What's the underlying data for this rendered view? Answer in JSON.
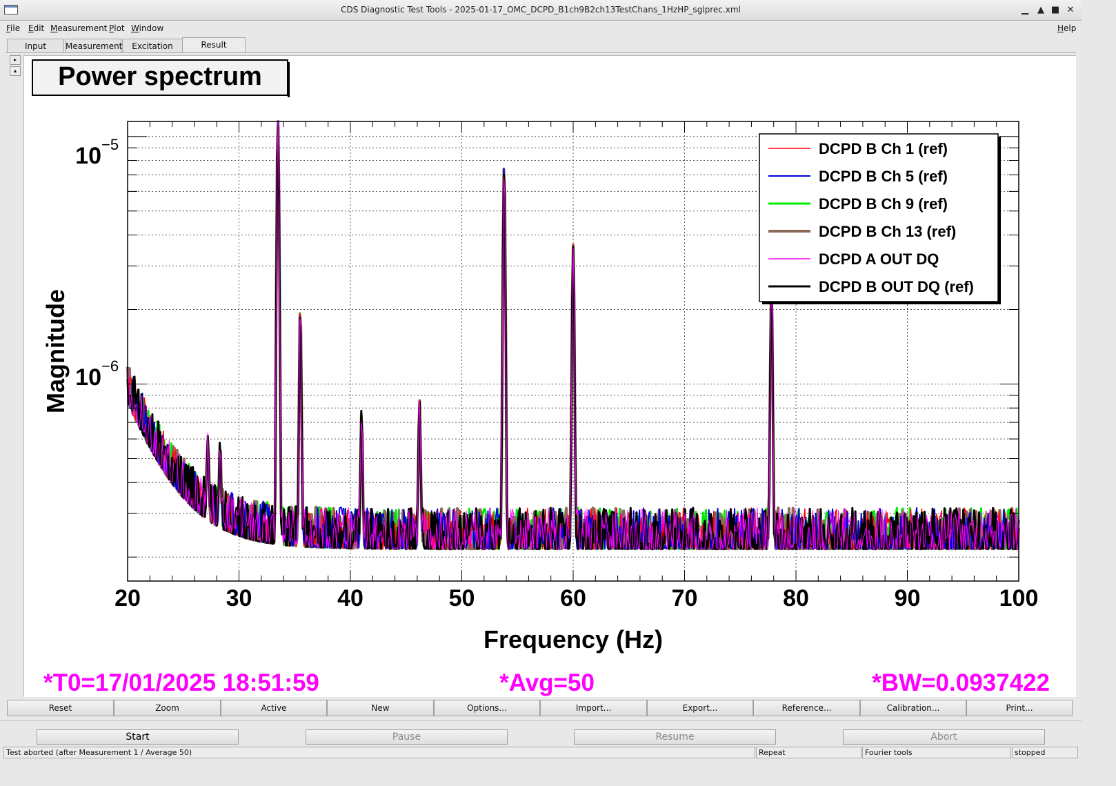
{
  "window": {
    "title": "CDS Diagnostic Test Tools - 2025-01-17_OMC_DCPD_B1ch9B2ch13TestChans_1HzHP_sglprec.xml",
    "controls": [
      "▁",
      "▲",
      "■",
      "✕"
    ]
  },
  "menubar": {
    "items": [
      {
        "label": "File",
        "acc": "F",
        "rest": "ile"
      },
      {
        "label": "Edit",
        "acc": "E",
        "rest": "dit"
      },
      {
        "label": "Measurement",
        "acc": "M",
        "rest": "easurement"
      },
      {
        "label": "Plot",
        "acc": "P",
        "rest": "lot"
      },
      {
        "label": "Window",
        "acc": "W",
        "rest": "indow"
      }
    ],
    "help": {
      "acc": "H",
      "rest": "elp"
    }
  },
  "tabs": [
    {
      "label": "Input",
      "active": false
    },
    {
      "label": "Measurement",
      "active": false
    },
    {
      "label": "Excitation",
      "active": false
    },
    {
      "label": "Result",
      "active": true
    }
  ],
  "side_buttons": [
    "▸",
    "▴"
  ],
  "plot": {
    "title": "Power spectrum",
    "xlabel": "Frequency (Hz)",
    "ylabel": "Magnitude",
    "ytick_labels": [
      {
        "base": "10",
        "exp": "−5"
      },
      {
        "base": "10",
        "exp": "−6"
      }
    ],
    "footer": {
      "t0": "*T0=17/01/2025 18:51:59",
      "avg": "*Avg=50",
      "bw": "*BW=0.0937422"
    },
    "footer_color": "#ff00ff"
  },
  "chart_data": {
    "type": "line",
    "title": "Power spectrum",
    "xlabel": "Frequency (Hz)",
    "ylabel": "Magnitude",
    "xlim": [
      20,
      100
    ],
    "ylim": [
      1.6e-07,
      1.15e-05
    ],
    "yscale": "log",
    "xticks": [
      20,
      30,
      40,
      50,
      60,
      70,
      80,
      90,
      100
    ],
    "grid": true,
    "legend_position": "top-right",
    "series": [
      {
        "name": "DCPD B Ch 1 (ref)",
        "color": "#ff0000",
        "width": 1.5
      },
      {
        "name": "DCPD B Ch 5 (ref)",
        "color": "#0000dd",
        "width": 2
      },
      {
        "name": "DCPD B Ch 9 (ref)",
        "color": "#00ee00",
        "width": 3
      },
      {
        "name": "DCPD B Ch 13 (ref)",
        "color": "#8b6a58",
        "width": 4
      },
      {
        "name": "DCPD A OUT DQ",
        "color": "#ff00ff",
        "width": 1
      },
      {
        "name": "DCPD B OUT DQ (ref)",
        "color": "#000000",
        "width": 3
      }
    ],
    "noise_floor": 2.4e-07,
    "low_freq_level": 7e-07,
    "peaks": [
      {
        "x": 27.2,
        "y": 6.5e-07
      },
      {
        "x": 28.3,
        "y": 6.2e-07
      },
      {
        "x": 33.5,
        "y": 1.25e-05
      },
      {
        "x": 35.5,
        "y": 2.1e-06
      },
      {
        "x": 41.0,
        "y": 8e-07
      },
      {
        "x": 46.2,
        "y": 9e-07
      },
      {
        "x": 53.8,
        "y": 8e-06
      },
      {
        "x": 60.0,
        "y": 3.8e-06
      },
      {
        "x": 77.8,
        "y": 2.6e-06
      }
    ]
  },
  "bottom_buttons": [
    "Reset",
    "Zoom",
    "Active",
    "New",
    "Options...",
    "Import...",
    "Export...",
    "Reference...",
    "Calibration...",
    "Print..."
  ],
  "run_buttons": [
    {
      "label": "Start",
      "enabled": true
    },
    {
      "label": "Pause",
      "enabled": false
    },
    {
      "label": "Resume",
      "enabled": false
    },
    {
      "label": "Abort",
      "enabled": false
    }
  ],
  "status": {
    "message": "Test aborted (after Measurement 1 / Average 50)",
    "repeat": "Repeat",
    "tools": "Fourier tools",
    "state": "stopped"
  }
}
